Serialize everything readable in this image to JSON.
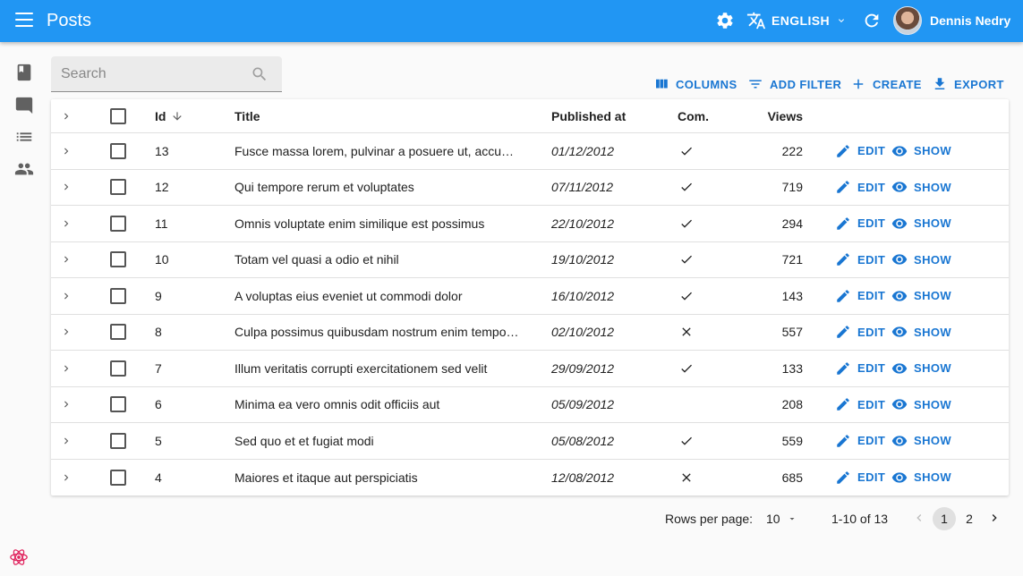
{
  "appbar": {
    "title": "Posts",
    "language": "ENGLISH",
    "user_name": "Dennis Nedry",
    "color": "#2196f3"
  },
  "sidebar": {
    "items": [
      {
        "icon": "book-icon"
      },
      {
        "icon": "comment-icon"
      },
      {
        "icon": "list-icon"
      },
      {
        "icon": "people-icon"
      }
    ]
  },
  "search": {
    "placeholder": "Search"
  },
  "toolbar": {
    "columns_label": "COLUMNS",
    "add_filter_label": "ADD FILTER",
    "create_label": "CREATE",
    "export_label": "EXPORT",
    "accent": "#1976d2"
  },
  "table": {
    "headers": {
      "id": "Id",
      "title": "Title",
      "published_at": "Published at",
      "commentable": "Com.",
      "views": "Views"
    },
    "sort": {
      "column": "Id",
      "direction": "desc"
    },
    "edit_label": "EDIT",
    "show_label": "SHOW",
    "rows": [
      {
        "id": "13",
        "title": "Fusce massa lorem, pulvinar a posuere ut, accumsan ac nisi",
        "published_at": "01/12/2012",
        "commentable": "check",
        "views": "222"
      },
      {
        "id": "12",
        "title": "Qui tempore rerum et voluptates",
        "published_at": "07/11/2012",
        "commentable": "check",
        "views": "719"
      },
      {
        "id": "11",
        "title": "Omnis voluptate enim similique est possimus",
        "published_at": "22/10/2012",
        "commentable": "check",
        "views": "294"
      },
      {
        "id": "10",
        "title": "Totam vel quasi a odio et nihil",
        "published_at": "19/10/2012",
        "commentable": "check",
        "views": "721"
      },
      {
        "id": "9",
        "title": "A voluptas eius eveniet ut commodi dolor",
        "published_at": "16/10/2012",
        "commentable": "check",
        "views": "143"
      },
      {
        "id": "8",
        "title": "Culpa possimus quibusdam nostrum enim tempore rerum odit excepturi",
        "published_at": "02/10/2012",
        "commentable": "cross",
        "views": "557"
      },
      {
        "id": "7",
        "title": "Illum veritatis corrupti exercitationem sed velit",
        "published_at": "29/09/2012",
        "commentable": "check",
        "views": "133"
      },
      {
        "id": "6",
        "title": "Minima ea vero omnis odit officiis aut",
        "published_at": "05/09/2012",
        "commentable": "none",
        "views": "208"
      },
      {
        "id": "5",
        "title": "Sed quo et et fugiat modi",
        "published_at": "05/08/2012",
        "commentable": "check",
        "views": "559"
      },
      {
        "id": "4",
        "title": "Maiores et itaque aut perspiciatis",
        "published_at": "12/08/2012",
        "commentable": "cross",
        "views": "685"
      }
    ]
  },
  "pagination": {
    "rows_per_page_label": "Rows per page:",
    "rows_per_page": "10",
    "range": "1-10 of 13",
    "pages": [
      "1",
      "2"
    ],
    "current_page": "1"
  }
}
